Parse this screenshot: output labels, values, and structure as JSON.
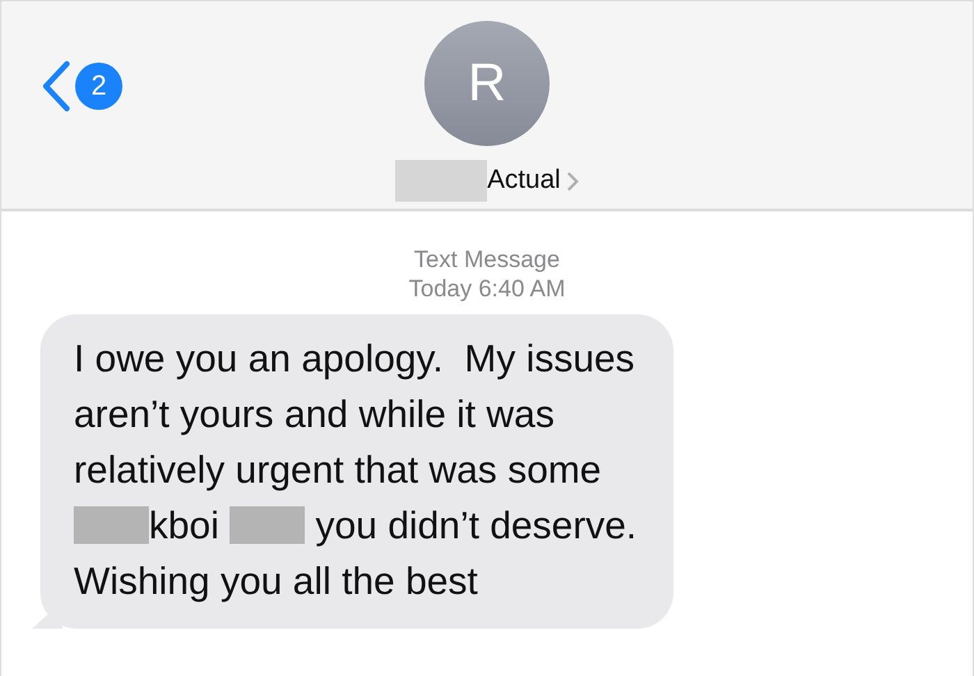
{
  "header": {
    "back_badge": "2",
    "avatar_initial": "R",
    "contact_name": [
      {
        "kind": "redacted"
      },
      {
        "kind": "text",
        "text": "Actual"
      }
    ]
  },
  "timestamp": {
    "label": "Text Message",
    "time": "Today 6:40 AM"
  },
  "messages": [
    {
      "outgoing": false,
      "lines": [
        [
          {
            "kind": "text",
            "text": "I owe you an apology.  My issues"
          }
        ],
        [
          {
            "kind": "text",
            "text": "aren’t yours and while it was"
          }
        ],
        [
          {
            "kind": "text",
            "text": "relatively urgent that was some"
          }
        ],
        [
          {
            "kind": "redacted"
          },
          {
            "kind": "text",
            "text": "kboi "
          },
          {
            "kind": "redacted"
          },
          {
            "kind": "text",
            "text": " you didn’t deserve."
          }
        ],
        [
          {
            "kind": "text",
            "text": "Wishing you all the best"
          }
        ]
      ]
    }
  ]
}
